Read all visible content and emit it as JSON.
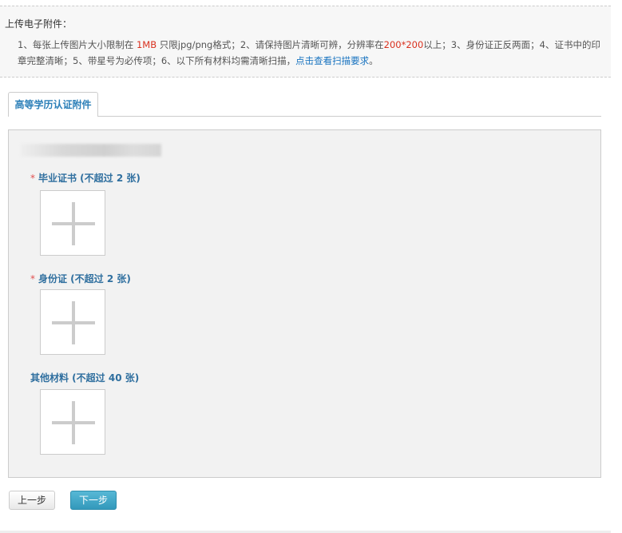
{
  "notice": {
    "title": "上传电子附件：",
    "parts": [
      "1、每张上传图片大小限制在 ",
      "1MB",
      " 只限jpg/png格式；2、请保持图片清晰可辨，分辨率在",
      "200*200",
      "以上；3、身份证正反两面；4、证书中的印章完整清晰；5、带星号为必传项；6、以下所有材料均需清晰扫描，",
      "点击查看扫描要求",
      "。"
    ]
  },
  "tab": {
    "label": "高等学历认证附件"
  },
  "sections": [
    {
      "required": "*",
      "label": "毕业证书 (不超过 2 张)"
    },
    {
      "required": "*",
      "label": "身份证 (不超过 2 张)"
    },
    {
      "label": "其他材料 (不超过 40 张)"
    }
  ],
  "buttons": {
    "prev": "上一步",
    "next": "下一步"
  }
}
